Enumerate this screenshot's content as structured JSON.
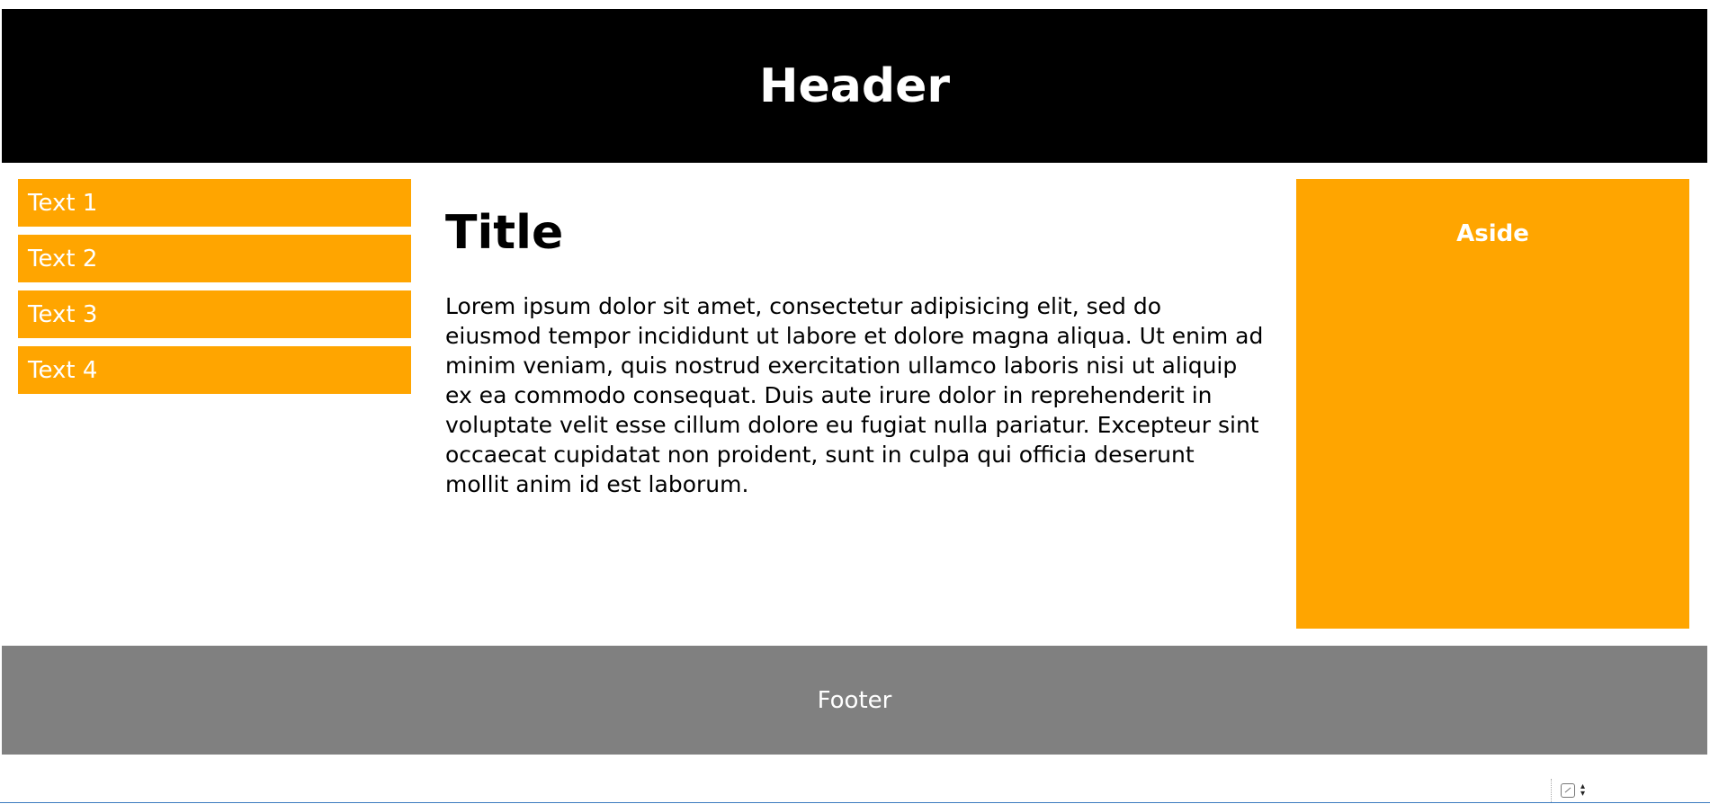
{
  "header": {
    "title": "Header"
  },
  "nav": {
    "items": [
      {
        "label": "Text 1"
      },
      {
        "label": "Text 2"
      },
      {
        "label": "Text 3"
      },
      {
        "label": "Text 4"
      }
    ]
  },
  "main": {
    "title": "Title",
    "body": "Lorem ipsum dolor sit amet, consectetur adipisicing elit, sed do eiusmod tempor incididunt ut labore et dolore magna aliqua. Ut enim ad minim veniam, quis nostrud exercitation ullamco laboris nisi ut aliquip ex ea commodo consequat. Duis aute irure dolor in reprehenderit in voluptate velit esse cillum dolore eu fugiat nulla pariatur. Excepteur sint occaecat cupidatat non proident, sunt in culpa qui officia deserunt mollit anim id est laborum."
  },
  "aside": {
    "title": "Aside"
  },
  "footer": {
    "text": "Footer"
  },
  "corner_widget": {
    "icons": [
      "checkbox-icon",
      "chevron-updown-icon"
    ]
  },
  "colors": {
    "header_bg": "#000000",
    "accent": "#ffa500",
    "footer_bg": "#808080",
    "text_light": "#ffffff",
    "text_dark": "#000000"
  }
}
